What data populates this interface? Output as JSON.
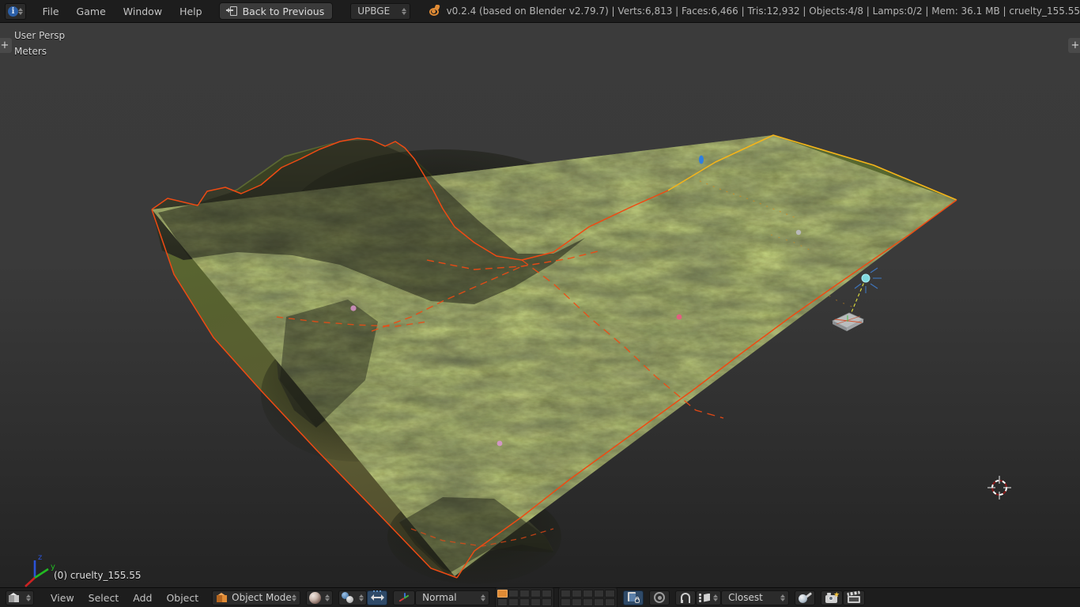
{
  "app": {
    "name": "UPBGE",
    "engine_label": "UPBGE",
    "version_status": "v0.2.4 (based on Blender v2.79.7)  | Verts:6,813 | Faces:6,466 | Tris:12,932 | Objects:4/8 | Lamps:0/2 | Mem: 36.1 MB | cruelty_155.55"
  },
  "topbar": {
    "editor_type_icon": "info-editor-icon",
    "menus": [
      {
        "label": "File"
      },
      {
        "label": "Game"
      },
      {
        "label": "Window"
      },
      {
        "label": "Help"
      }
    ],
    "back_button": {
      "label": "Back to Previous",
      "icon": "back-arrow-icon"
    },
    "engine_dropdown": {
      "value": "UPBGE",
      "icon": "chevron-updown-icon"
    },
    "blender_icon": "blender-logo-icon"
  },
  "viewport": {
    "perspective": "User Persp",
    "units": "Meters",
    "active_object_label": "(0) cruelty_155.55",
    "left_tab": "+",
    "right_tab": "+",
    "axis_gizmo": {
      "x_label": "x",
      "y_label": "y",
      "z_label": "z",
      "x_color": "#cc2222",
      "y_color": "#22bb22",
      "z_color": "#2b53d8"
    },
    "cursor_3d": "3d-cursor-icon",
    "colors": {
      "background_top": "#3b3b3b",
      "background_bottom": "#232323",
      "selected_outline": "#ef4a13",
      "active_outline": "#f4b41a",
      "lamp": "#7fd9e0",
      "relationship_line": "#d8d83c"
    }
  },
  "bottombar": {
    "editor_type_icon": "3d-view-editor-icon",
    "menus": [
      {
        "label": "View"
      },
      {
        "label": "Select"
      },
      {
        "label": "Add"
      },
      {
        "label": "Object"
      }
    ],
    "mode_dropdown": {
      "value": "Object Mode",
      "icon": "object-mode-cube-icon"
    },
    "viewport_shading": {
      "value": "viewport-shading-material-icon"
    },
    "pivot_dropdown": {
      "value": "pivot-median-point-icon"
    },
    "manipulator_toggle": {
      "value": "translate-manipulator-icon"
    },
    "transform_orientation": {
      "icon": "orientation-axis-icon",
      "value": "Normal"
    },
    "layers": {
      "group_a": [
        true,
        false,
        false,
        false,
        false,
        false,
        false,
        false,
        false,
        false
      ],
      "group_b": [
        false,
        false,
        false,
        false,
        false,
        false,
        false,
        false,
        false,
        false
      ]
    },
    "lock_scene_button": "lock-scene-to-view-icon",
    "proportional_edit": "proportional-editing-icon",
    "snap_magnet": "snap-magnet-icon",
    "snap_element": "snap-element-volume-icon",
    "snap_target_dropdown": {
      "value": "Closest"
    },
    "texture_paint": "texture-paint-icon",
    "render_button": "render-image-icon",
    "render_animation_button": "render-animation-icon"
  }
}
